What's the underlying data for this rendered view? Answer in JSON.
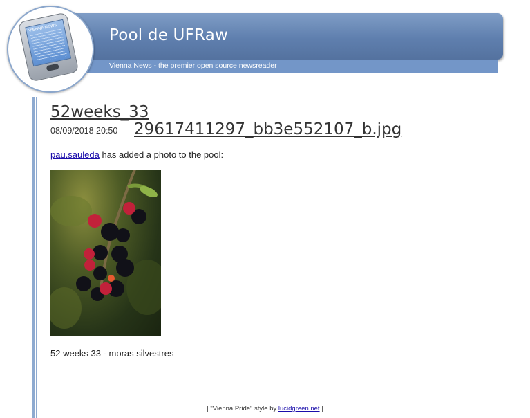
{
  "header": {
    "title": "Pool de UFRaw",
    "tagline": "Vienna News - the premier open source newsreader",
    "logo_text": "VIENNA NEWS"
  },
  "post": {
    "title": "52weeks_33",
    "date": "08/09/2018 20:50",
    "file_name": "29617411297_bb3e552107_b.jpg",
    "author": "pau.sauleda",
    "added_text": "has added a photo to the pool:",
    "caption": "52 weeks 33 - moras silvestres"
  },
  "footer": {
    "prefix": "| \"Vienna Pride\" style by",
    "link": "lucidgreen.net",
    "suffix": "|"
  },
  "colors": {
    "header_blue": "#5f7fae",
    "tagline_blue": "#7396c8",
    "link_blue": "#1a0dab"
  }
}
